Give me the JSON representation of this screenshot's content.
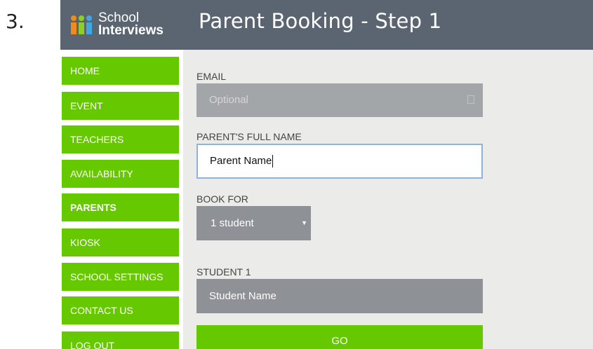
{
  "step_number": "3.",
  "logo": {
    "line1": "School",
    "line2": "Interviews"
  },
  "page_title": "Parent Booking - Step 1",
  "sidebar": {
    "items": [
      {
        "label": "HOME"
      },
      {
        "label": "EVENT"
      },
      {
        "label": "TEACHERS"
      },
      {
        "label": "AVAILABILITY"
      },
      {
        "label": "PARENTS",
        "active": true
      },
      {
        "label": "KIOSK"
      },
      {
        "label": "SCHOOL SETTINGS"
      },
      {
        "label": "CONTACT US"
      },
      {
        "label": "LOG OUT"
      }
    ]
  },
  "form": {
    "email_label": "EMAIL",
    "email_placeholder": "Optional",
    "parent_name_label": "PARENT'S FULL NAME",
    "parent_name_value": "Parent Name",
    "book_for_label": "BOOK FOR",
    "book_for_value": "1 student",
    "student1_label": "STUDENT 1",
    "student1_placeholder": "Student Name",
    "go_label": "GO"
  },
  "colors": {
    "header_bg": "#5a6571",
    "nav_green": "#66c900",
    "main_bg": "#ebebea",
    "field_gray": "#8e9296"
  }
}
